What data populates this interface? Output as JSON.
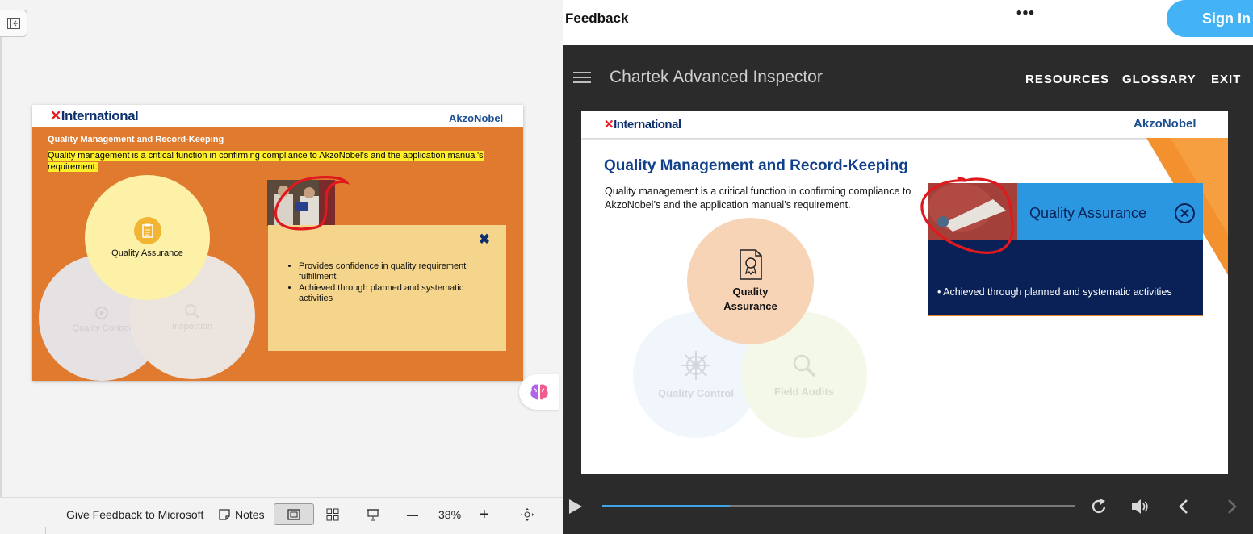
{
  "left_pane": {
    "slide": {
      "brand_left_x": "✕",
      "brand_left": "International",
      "brand_right": "AkzoNobel",
      "title": "Quality Management and Record-Keeping",
      "description": "Quality management is a critical function in confirming compliance to AkzoNobel’s and the application manual’s requirement.",
      "circles": {
        "qa": "Quality Assurance",
        "qc": "Quality Control",
        "inspection": "Inspection"
      },
      "popup": {
        "close": "✖",
        "bullets": [
          "Provides confidence in quality requirement fulfillment",
          "Achieved through planned and systematic activities"
        ]
      }
    },
    "status_bar": {
      "feedback": "Give Feedback to Microsoft",
      "notes": "Notes",
      "zoom_minus": "—",
      "zoom": "38%",
      "zoom_plus": "+"
    },
    "colors": {
      "slide_bg": "#e07a2e",
      "highlight": "#ffef2a",
      "popup_bg": "#f5d58c"
    }
  },
  "right_pane": {
    "feedback_bar": {
      "title": "Feedback",
      "more": "•••",
      "sign_in": "Sign In"
    },
    "header": {
      "course_title": "Chartek Advanced Inspector",
      "nav": [
        "RESOURCES",
        "GLOSSARY",
        "EXIT"
      ]
    },
    "slide": {
      "brand_left_x": "✕",
      "brand_left": "International",
      "brand_right": "AkzoNobel",
      "title": "Quality Management and Record-Keeping",
      "description": "Quality management is a critical function in confirming compliance to AkzoNobel’s and the application manual’s requirement.",
      "circles": {
        "qa": "Quality Assurance",
        "qc": "Quality Control",
        "field_audits": "Field Audits"
      },
      "popup": {
        "title": "Quality Assurance",
        "close": "✕",
        "bullet": "• Achieved through planned and systematic activities"
      }
    },
    "controls": {
      "progress": 0.27
    },
    "colors": {
      "player_bg": "#2b2b2b",
      "accent_blue": "#43b3f5",
      "title_blue": "#10408b",
      "popup_head": "#2a97e0",
      "popup_body": "#0a2158",
      "annotation_red": "#e0191e"
    }
  }
}
